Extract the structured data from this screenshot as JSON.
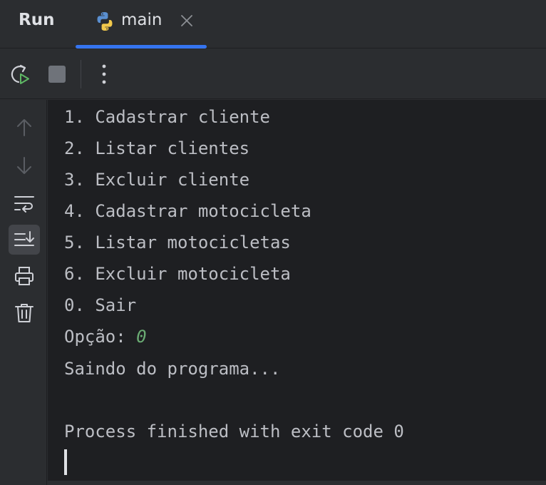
{
  "tabbar": {
    "run_title": "Run",
    "tab_label": "main"
  },
  "colors": {
    "accent": "#3574f0",
    "console_bg": "#1e1f22",
    "panel_bg": "#2b2d30",
    "input_text": "#6aab73"
  },
  "toolbar": {
    "icons": [
      "rerun-icon",
      "stop-icon",
      "more-options-icon"
    ]
  },
  "sidebar": {
    "icons": [
      "scroll-up-icon",
      "scroll-down-icon",
      "soft-wrap-icon",
      "scroll-to-end-icon",
      "print-icon",
      "trash-icon"
    ]
  },
  "console": {
    "lines": [
      "1. Cadastrar cliente",
      "2. Listar clientes",
      "3. Excluir cliente",
      "4. Cadastrar motocicleta",
      "5. Listar motocicletas",
      "6. Excluir motocicleta",
      "0. Sair"
    ],
    "prompt": "Opção: ",
    "input_value": "0",
    "exit_message": "Saindo do programa...",
    "process_message": "Process finished with exit code 0"
  }
}
